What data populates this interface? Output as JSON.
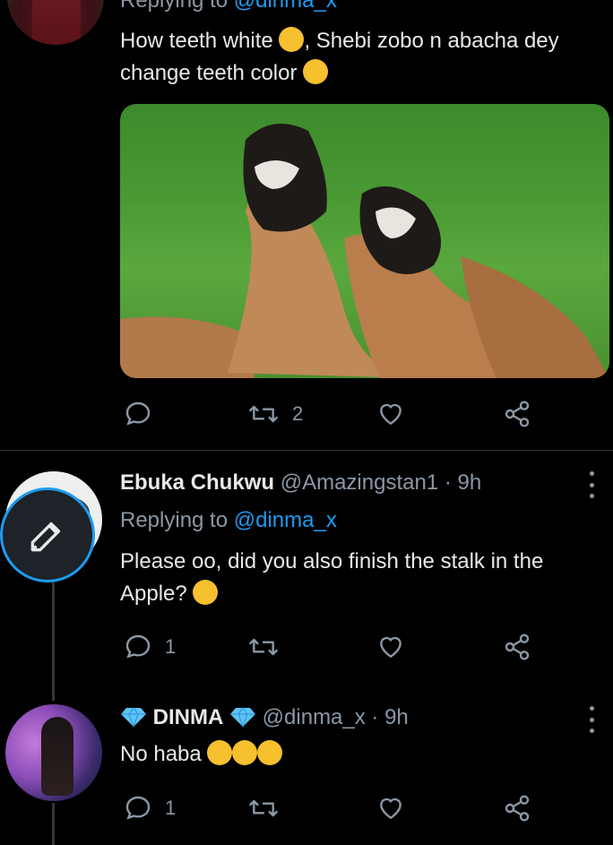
{
  "tweet1": {
    "replying_prefix": "Replying to",
    "replying_handle": "@dinma_x",
    "text": "How teeth white",
    "text_rest": ", Shebi zobo n abacha dey change teeth color",
    "retweet_count": "2"
  },
  "tweet2": {
    "name": "Ebuka Chukwu",
    "handle": "@Amazingstan1",
    "time": "· 9h",
    "replying_prefix": "Replying to",
    "replying_handle": "@dinma_x",
    "text": "Please oo, did you also finish the stalk in the Apple?",
    "reply_count": "1"
  },
  "tweet3": {
    "name": "DINMA",
    "handle": "@dinma_x",
    "time": "· 9h",
    "text": "No haba",
    "reply_count": "1"
  },
  "colors": {
    "accent": "#1d9bf0",
    "muted": "#8b98a5",
    "background": "#000000"
  }
}
